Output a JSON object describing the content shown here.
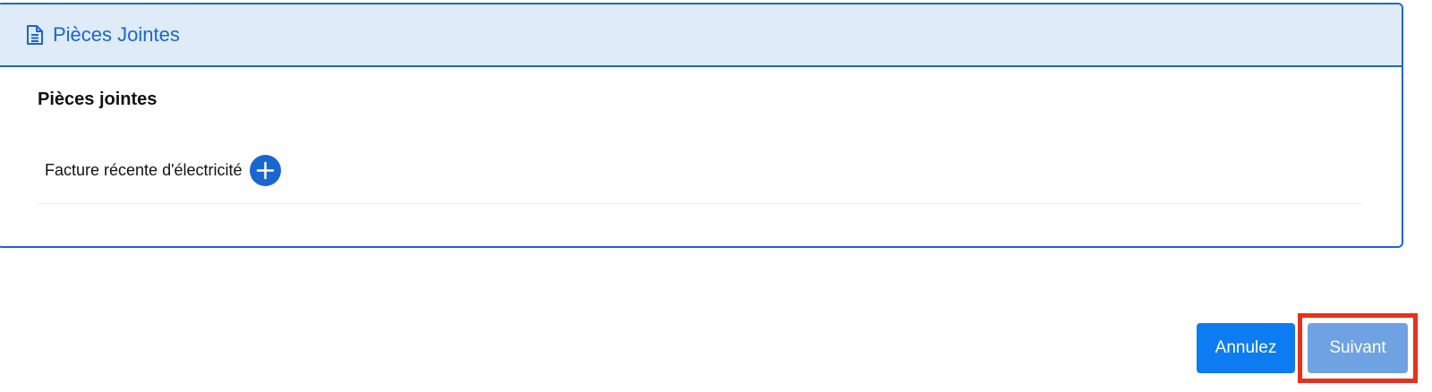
{
  "card": {
    "header_title": "Pièces Jointes",
    "header_icon": "file-text-icon",
    "section_title": "Pièces jointes",
    "attachments": [
      {
        "label": "Facture récente d'électricité",
        "action_icon": "plus-circle-icon"
      }
    ]
  },
  "footer": {
    "cancel_label": "Annulez",
    "next_label": "Suivant"
  },
  "colors": {
    "accent": "#1a66d0",
    "header_bg": "#dfebf8",
    "cancel_button": "#0d7bf2",
    "next_button": "#6ea2e2",
    "highlight": "#e8301a"
  }
}
